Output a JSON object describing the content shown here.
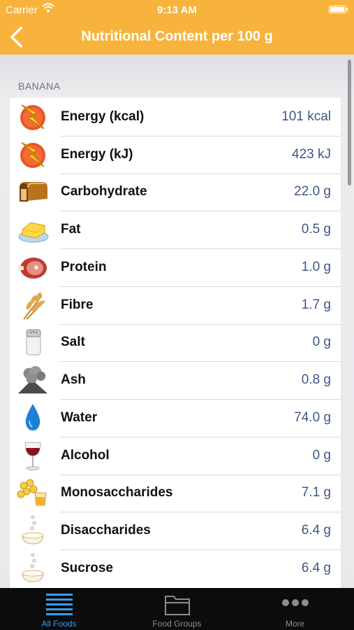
{
  "status": {
    "carrier": "Carrier",
    "time": "9:13 AM"
  },
  "nav": {
    "title": "Nutritional Content per 100 g"
  },
  "section": {
    "header": "BANANA"
  },
  "rows": [
    {
      "label": "Energy (kcal)",
      "value": "101 kcal",
      "icon": "lightning-icon"
    },
    {
      "label": "Energy (kJ)",
      "value": "423 kJ",
      "icon": "lightning-icon"
    },
    {
      "label": "Carbohydrate",
      "value": "22.0 g",
      "icon": "bread-icon"
    },
    {
      "label": "Fat",
      "value": "0.5 g",
      "icon": "butter-icon"
    },
    {
      "label": "Protein",
      "value": "1.0 g",
      "icon": "ham-icon"
    },
    {
      "label": "Fibre",
      "value": "1.7 g",
      "icon": "wheat-icon"
    },
    {
      "label": "Salt",
      "value": "0 g",
      "icon": "salt-shaker-icon"
    },
    {
      "label": "Ash",
      "value": "0.8 g",
      "icon": "volcano-icon"
    },
    {
      "label": "Water",
      "value": "74.0 g",
      "icon": "water-drop-icon"
    },
    {
      "label": "Alcohol",
      "value": "0 g",
      "icon": "wine-glass-icon"
    },
    {
      "label": "Monosaccharides",
      "value": "7.1 g",
      "icon": "honey-icon"
    },
    {
      "label": "Disaccharides",
      "value": "6.4 g",
      "icon": "sugar-bowl-icon"
    },
    {
      "label": "Sucrose",
      "value": "6.4 g",
      "icon": "sugar-bowl-icon"
    }
  ],
  "tabs": [
    {
      "label": "All Foods",
      "icon": "list-icon",
      "active": true
    },
    {
      "label": "Food Groups",
      "icon": "folder-icon",
      "active": false
    },
    {
      "label": "More",
      "icon": "more-dots-icon",
      "active": false
    }
  ],
  "colors": {
    "accent": "#f7b33c",
    "value_text": "#3f5685",
    "tab_active": "#3b9bea"
  }
}
